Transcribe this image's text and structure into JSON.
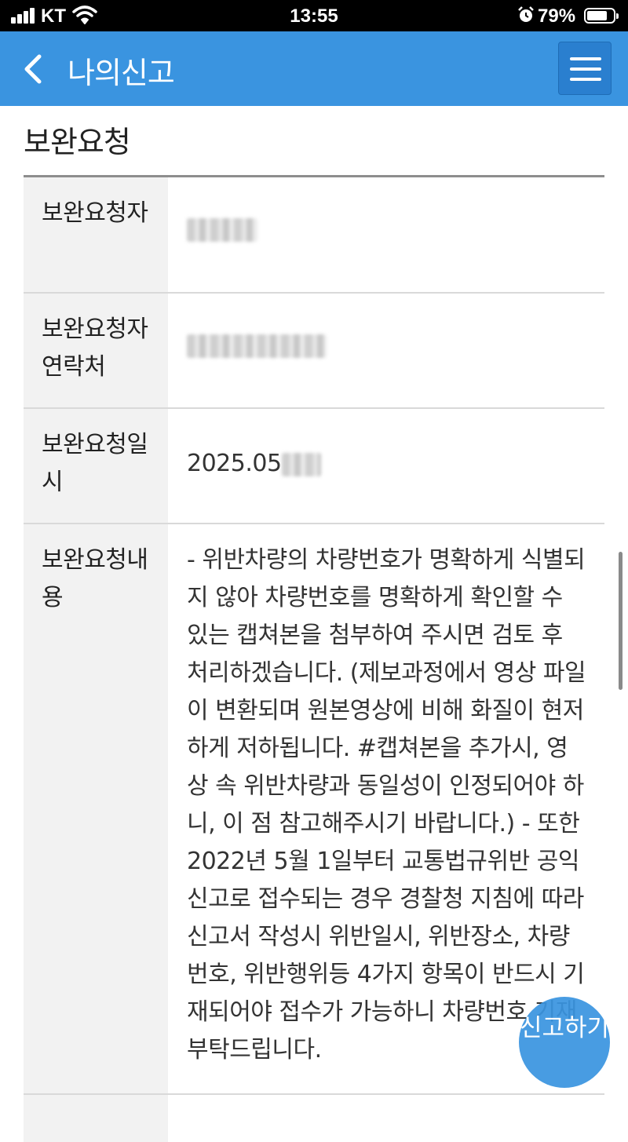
{
  "status_bar": {
    "carrier": "KT",
    "time": "13:55",
    "battery_percent": "79%",
    "battery_level": 0.79,
    "icons": [
      "signal-icon",
      "wifi-icon",
      "alarm-icon",
      "battery-icon"
    ]
  },
  "header": {
    "title": "나의신고",
    "background_color": "#3a94e0",
    "icons": [
      "back-chevron-icon",
      "hamburger-menu-icon"
    ]
  },
  "section": {
    "title": "보완요청"
  },
  "details": {
    "requester_label": "보완요청자",
    "contact_label": "보완요청자 연락처",
    "datetime_label": "보완요청일시",
    "datetime_value": "2025.05",
    "content_label": "보완요청내용",
    "content_value": "- 위반차량의 차량번호가 명확하게 식별되지 않아 차량번호를 명확하게 확인할 수 있는 캡쳐본을 첨부하여 주시면 검토 후 처리하겠습니다. (제보과정에서 영상 파일이 변환되며 원본영상에 비해 화질이 현저하게 저하됩니다. #캡쳐본을 추가시, 영상 속 위반차량과 동일성이 인정되어야 하니, 이 점 참고해주시기 바랍니다.) - 또한 2022년 5월 1일부터 교통법규위반 공익신고로 접수되는 경우 경찰청 지침에 따라 신고서 작성시 위반일시, 위반장소, 차량번호, 위반행위등 4가지 항목이 반드시 기재되어야 접수가 가능하니 차량번호 기재부탁드립니다."
  },
  "fab": {
    "label": "신고하기"
  }
}
